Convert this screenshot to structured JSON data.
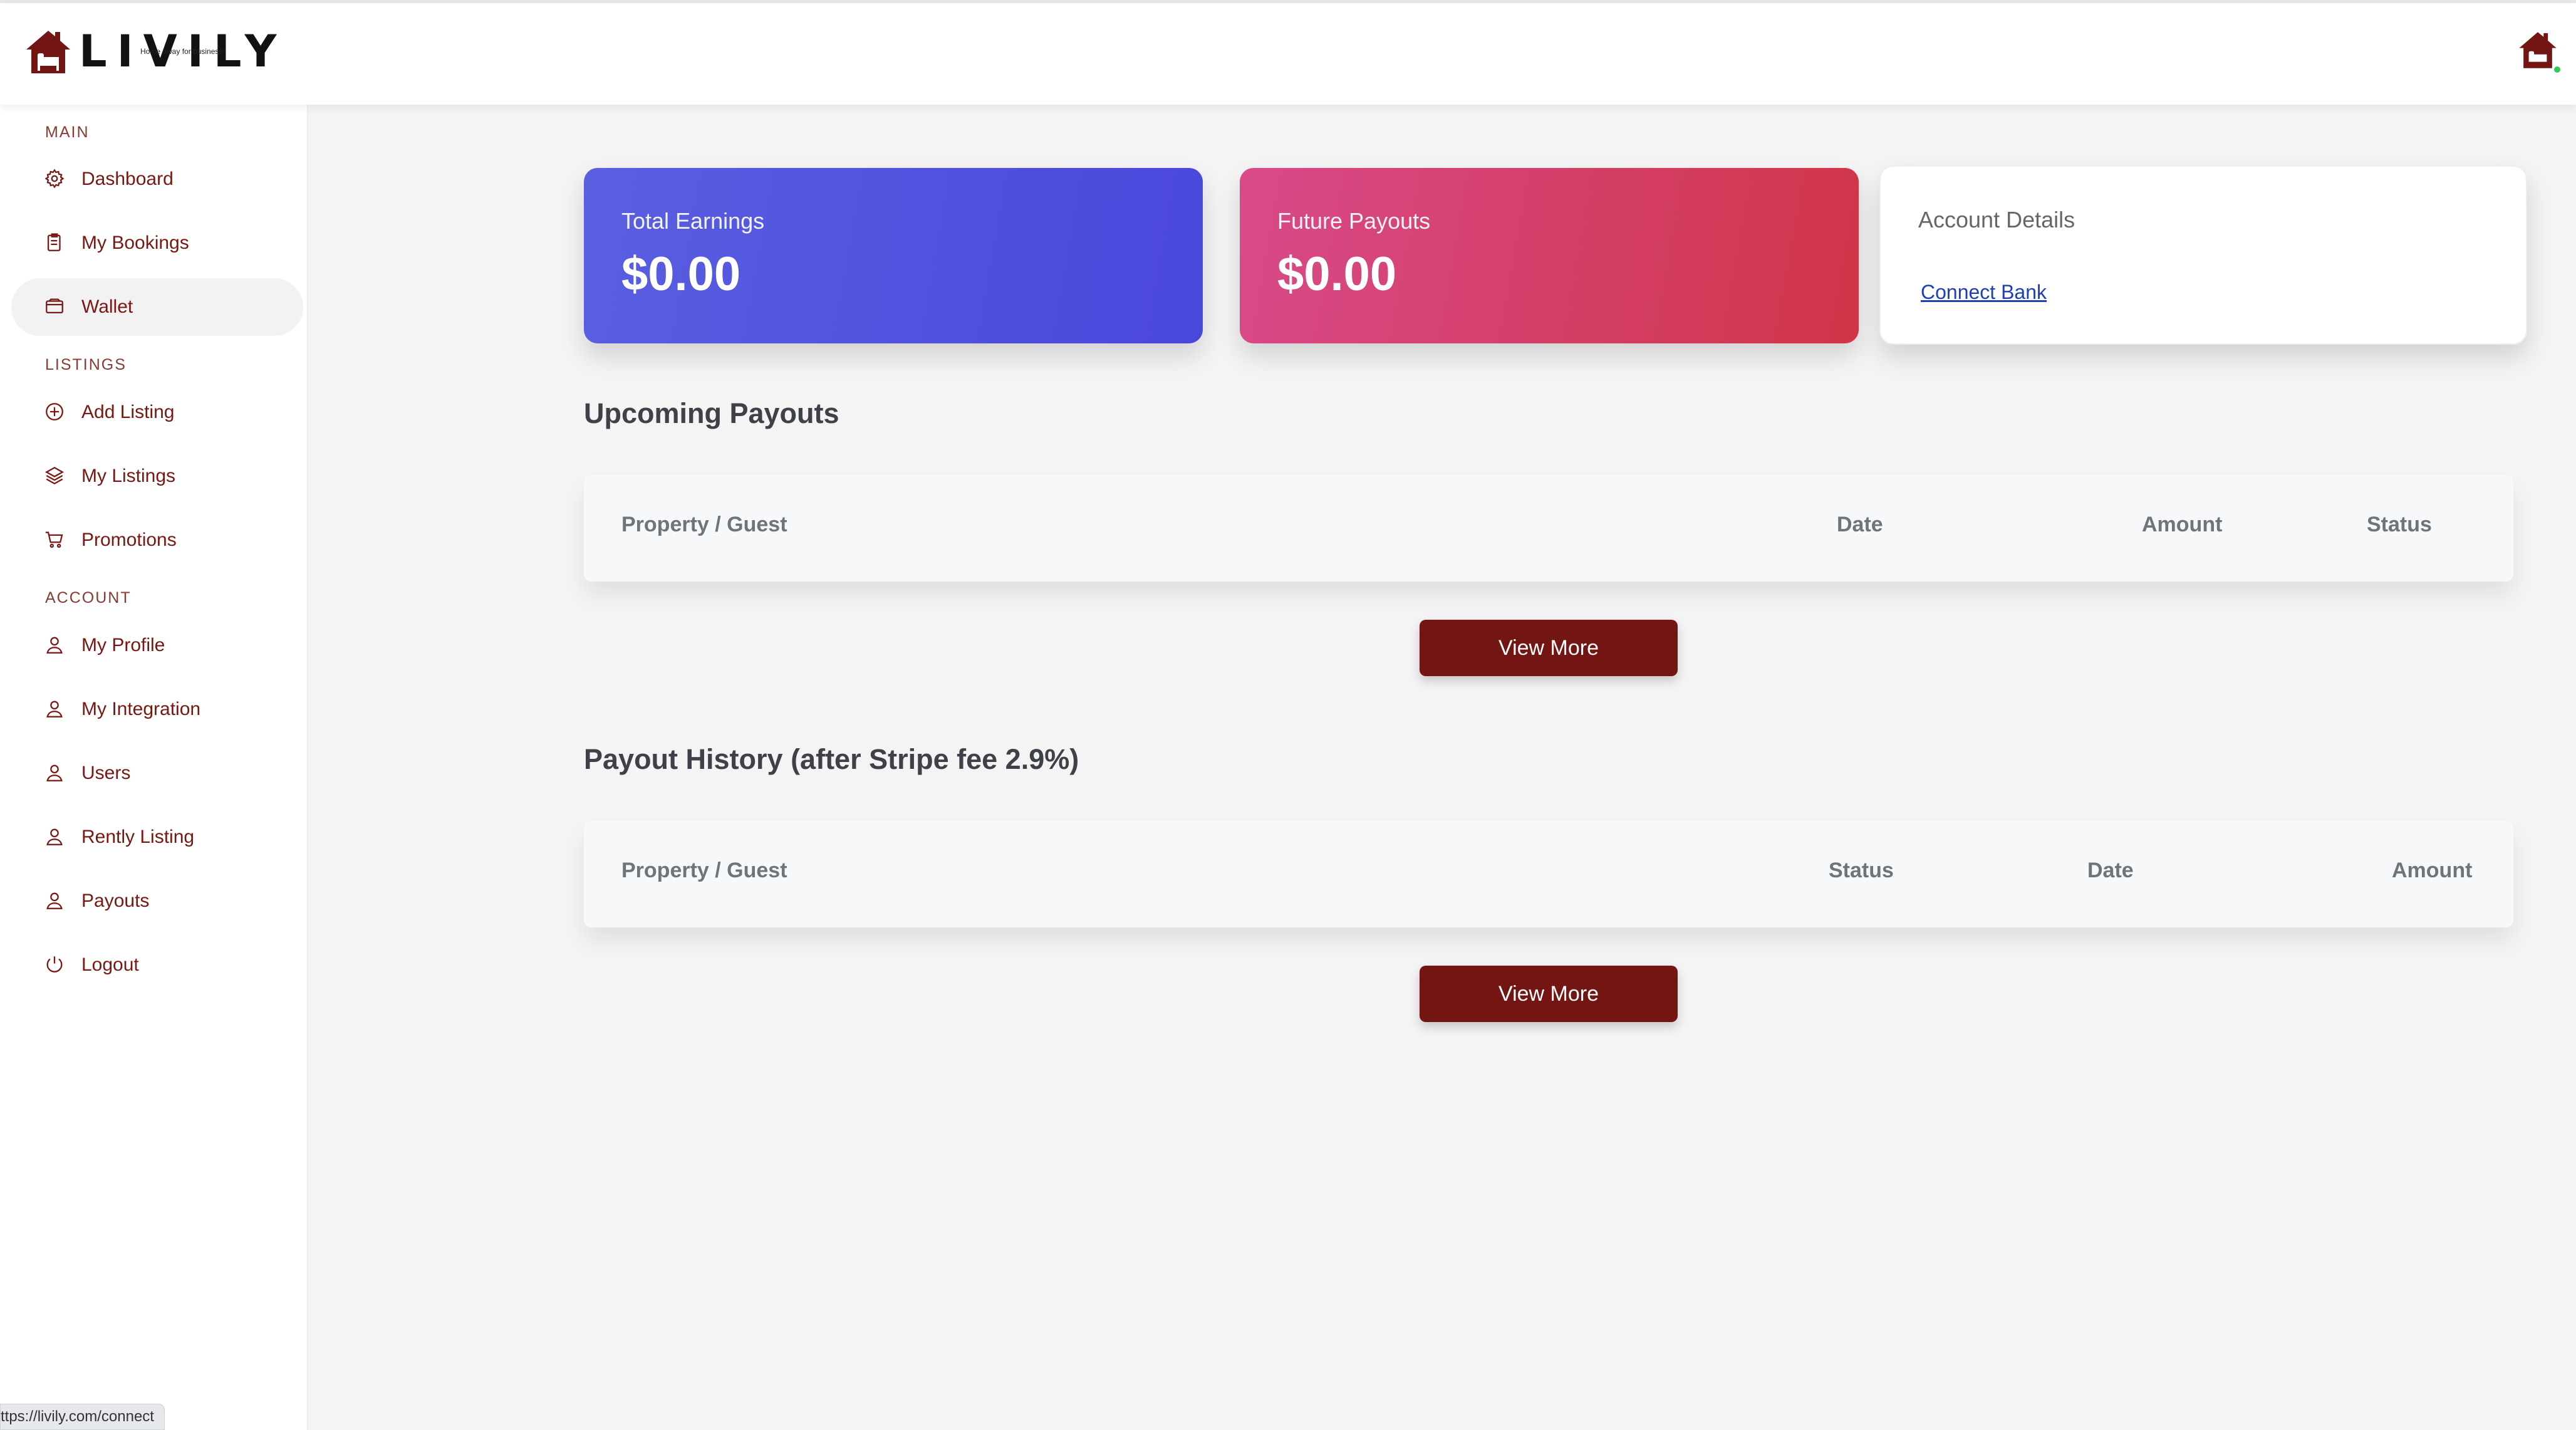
{
  "brand": {
    "name": "LIVILY",
    "tagline": "Home away for business!",
    "color": "#731512"
  },
  "sidebar": {
    "sections": [
      {
        "label": "MAIN",
        "items": [
          {
            "label": "Dashboard",
            "icon": "gear-icon"
          },
          {
            "label": "My Bookings",
            "icon": "clipboard-icon"
          },
          {
            "label": "Wallet",
            "icon": "wallet-icon",
            "active": true
          }
        ]
      },
      {
        "label": "LISTINGS",
        "items": [
          {
            "label": "Add Listing",
            "icon": "plus-circle-icon"
          },
          {
            "label": "My Listings",
            "icon": "layers-icon"
          },
          {
            "label": "Promotions",
            "icon": "cart-icon"
          }
        ]
      },
      {
        "label": "ACCOUNT",
        "items": [
          {
            "label": "My Profile",
            "icon": "user-icon"
          },
          {
            "label": "My Integration",
            "icon": "user-icon"
          },
          {
            "label": "Users",
            "icon": "user-icon"
          },
          {
            "label": "Rently Listing",
            "icon": "user-icon"
          },
          {
            "label": "Payouts",
            "icon": "user-icon"
          },
          {
            "label": "Logout",
            "icon": "power-icon"
          }
        ]
      }
    ]
  },
  "cards": {
    "total_earnings": {
      "label": "Total Earnings",
      "value": "$0.00",
      "color": "#4f4fdf"
    },
    "future_payouts": {
      "label": "Future Payouts",
      "value": "$0.00",
      "color": "#d3405f"
    },
    "account_details": {
      "label": "Account Details",
      "link": "Connect Bank"
    }
  },
  "upcoming": {
    "title": "Upcoming Payouts",
    "columns": [
      "Property / Guest",
      "Date",
      "Amount",
      "Status"
    ],
    "rows": [],
    "button": "View More"
  },
  "history": {
    "title": "Payout History (after Stripe fee 2.9%)",
    "columns": [
      "Property / Guest",
      "Status",
      "Date",
      "Amount"
    ],
    "rows": [],
    "button": "View More"
  },
  "status_bar_url": "ttps://livily.com/connect"
}
